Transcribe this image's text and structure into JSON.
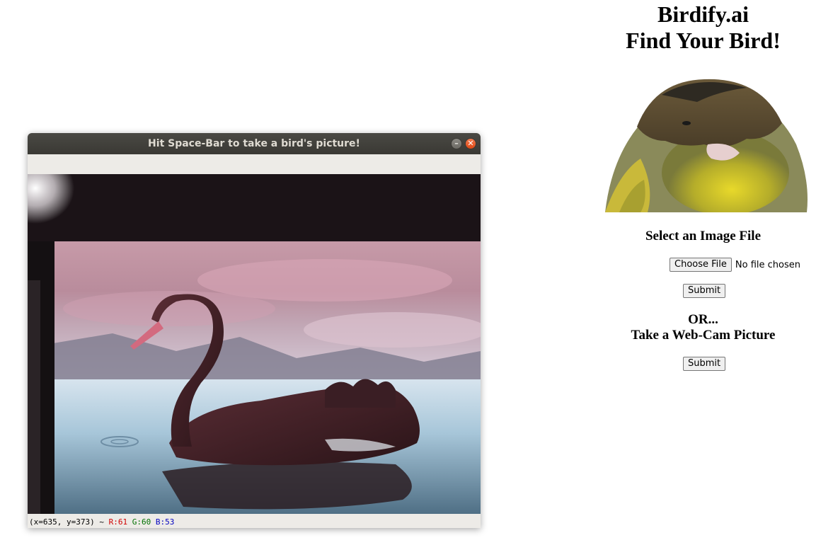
{
  "site": {
    "title_line1": "Birdify.ai",
    "title_line2": "Find Your Bird!",
    "select_title": "Select an Image File",
    "choose_file_label": "Choose File",
    "no_file_text": "No file chosen",
    "submit_label": "Submit",
    "or_text": "OR...",
    "webcam_title": "Take a Web-Cam Picture",
    "submit2_label": "Submit"
  },
  "window": {
    "title": "Hit Space-Bar to take a bird's picture!",
    "minimize_icon": "–",
    "close_icon": "✕",
    "status": {
      "coords": "(x=635, y=373) ~ ",
      "r": "R:61",
      "g": "G:60",
      "b": "B:53"
    }
  },
  "icons": {
    "minimize": "minimize-icon",
    "close": "close-icon"
  },
  "colors": {
    "titlebar": "#3c3b37",
    "close_button": "#e95420",
    "window_bg": "#edebe7"
  }
}
